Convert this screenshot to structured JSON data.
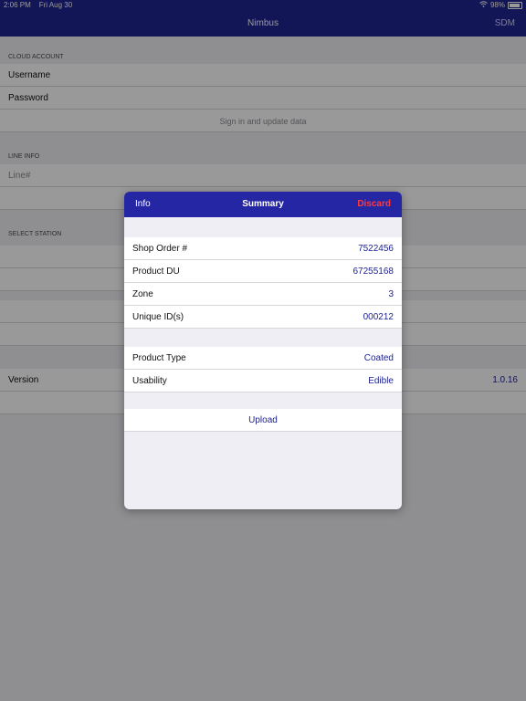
{
  "status_bar": {
    "time": "2:06 PM",
    "date": "Fri Aug 30",
    "battery": "98%",
    "icons": [
      "wifi-icon",
      "battery-icon"
    ]
  },
  "nav": {
    "title": "Nimbus",
    "right": "SDM"
  },
  "cloud_account": {
    "section": "CLOUD ACCOUNT",
    "username_label": "Username",
    "password_label": "Password",
    "signin": "Sign in and update data"
  },
  "line_info": {
    "section": "LINE INFO",
    "line_placeholder": "Line#"
  },
  "select_station": {
    "section": "SELECT STATION"
  },
  "version": {
    "label": "Version",
    "value": "1.0.16"
  },
  "summary": {
    "header": {
      "left": "Info",
      "title": "Summary",
      "right": "Discard"
    },
    "group1": [
      {
        "label": "Shop Order #",
        "value": "7522456"
      },
      {
        "label": "Product DU",
        "value": "67255168"
      },
      {
        "label": "Zone",
        "value": "3"
      },
      {
        "label": "Unique ID(s)",
        "value": "000212"
      }
    ],
    "group2": [
      {
        "label": "Product Type",
        "value": "Coated"
      },
      {
        "label": "Usability",
        "value": "Edible"
      }
    ],
    "upload": "Upload"
  },
  "colors": {
    "nav_bg": "#1f238f",
    "modal_header": "#2426a4",
    "accent": "#1f238f",
    "discard": "#ff3b3b"
  }
}
